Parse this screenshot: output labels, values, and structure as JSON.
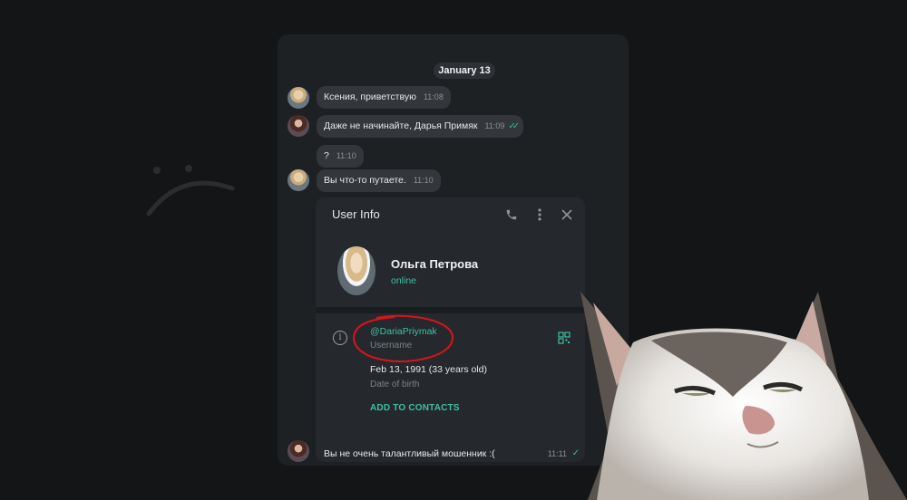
{
  "chat": {
    "date_label": "January 13",
    "messages": [
      {
        "text": "Ксения, приветствую",
        "time": "11:08"
      },
      {
        "text": "Даже не начинайте, Дарья Примяк",
        "time": "11:09",
        "status": "read"
      },
      {
        "text": "?",
        "time": "11:10"
      },
      {
        "text": "Вы что-то путаете.",
        "time": "11:10"
      },
      {
        "text": "Вы не очень талантливый мошенник :(",
        "time": "11:11",
        "status": "sent"
      }
    ]
  },
  "user_info": {
    "title": "User Info",
    "name": "Ольга Петрова",
    "status": "online",
    "username": "@DariaPriymak",
    "username_label": "Username",
    "birth_date": "Feb 13, 1991 (33 years old)",
    "birth_label": "Date of birth",
    "add_contacts": "ADD TO CONTACTS",
    "icons": [
      "phone-icon",
      "more-vertical-icon",
      "close-icon",
      "info-icon",
      "qr-code-icon"
    ]
  },
  "colors": {
    "background": "#141516",
    "window": "#1e2124",
    "bubble": "#33363a",
    "accent": "#3fbfa4",
    "annotation": "#d8141c"
  }
}
